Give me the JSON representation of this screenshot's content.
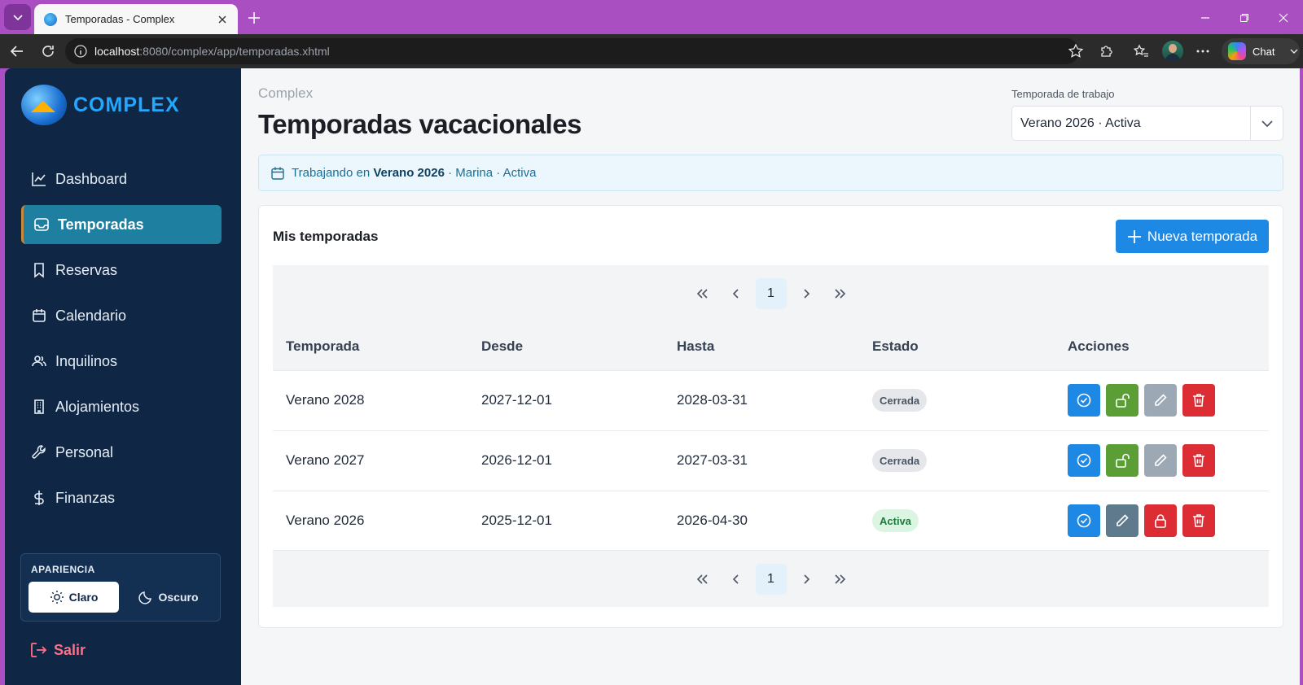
{
  "browser": {
    "tab_title": "Temporadas - Complex",
    "url_host": "localhost",
    "url_path": ":8080/complex/app/temporadas.xhtml",
    "chat_label": "Chat"
  },
  "sidebar": {
    "logo_text": "COMPLEX",
    "items": [
      {
        "label": "Dashboard",
        "icon": "chart-line-icon"
      },
      {
        "label": "Temporadas",
        "icon": "inbox-icon",
        "active": true
      },
      {
        "label": "Reservas",
        "icon": "bookmark-icon"
      },
      {
        "label": "Calendario",
        "icon": "calendar-icon"
      },
      {
        "label": "Inquilinos",
        "icon": "users-icon"
      },
      {
        "label": "Alojamientos",
        "icon": "building-icon"
      },
      {
        "label": "Personal",
        "icon": "wrench-icon"
      },
      {
        "label": "Finanzas",
        "icon": "dollar-icon"
      }
    ],
    "appearance": {
      "title": "APARIENCIA",
      "light": "Claro",
      "dark": "Oscuro",
      "selected": "Claro"
    },
    "logout": "Salir"
  },
  "header": {
    "breadcrumb": "Complex",
    "title": "Temporadas vacacionales",
    "work_season_label": "Temporada de trabajo",
    "work_season_value": "Verano 2026 · Activa"
  },
  "banner": {
    "prefix": "Trabajando en",
    "season": "Verano 2026",
    "suffix": "· Marina · Activa"
  },
  "card": {
    "title": "Mis temporadas",
    "new_button": "Nueva temporada",
    "pager": {
      "first": "«",
      "prev": "‹",
      "page": "1",
      "next": "›",
      "last": "»"
    },
    "columns": [
      "Temporada",
      "Desde",
      "Hasta",
      "Estado",
      "Acciones"
    ],
    "rows": [
      {
        "name": "Verano 2028",
        "from": "2027-12-01",
        "to": "2028-03-31",
        "status": "Cerrada",
        "actions": [
          "activate",
          "unlock",
          "edit-disabled",
          "delete"
        ]
      },
      {
        "name": "Verano 2027",
        "from": "2026-12-01",
        "to": "2027-03-31",
        "status": "Cerrada",
        "actions": [
          "activate",
          "unlock",
          "edit-disabled",
          "delete"
        ]
      },
      {
        "name": "Verano 2026",
        "from": "2025-12-01",
        "to": "2026-04-30",
        "status": "Activa",
        "actions": [
          "activate",
          "edit",
          "lock",
          "delete"
        ]
      }
    ]
  },
  "colors": {
    "titlebar": "#a94fc2",
    "sidebar": "#0f2744",
    "active_item": "#1f7fa0",
    "primary": "#1e88e5",
    "success": "#5a9e35",
    "danger": "#dc2c34",
    "muted": "#9ca8b4",
    "slate": "#5e7a8c"
  }
}
